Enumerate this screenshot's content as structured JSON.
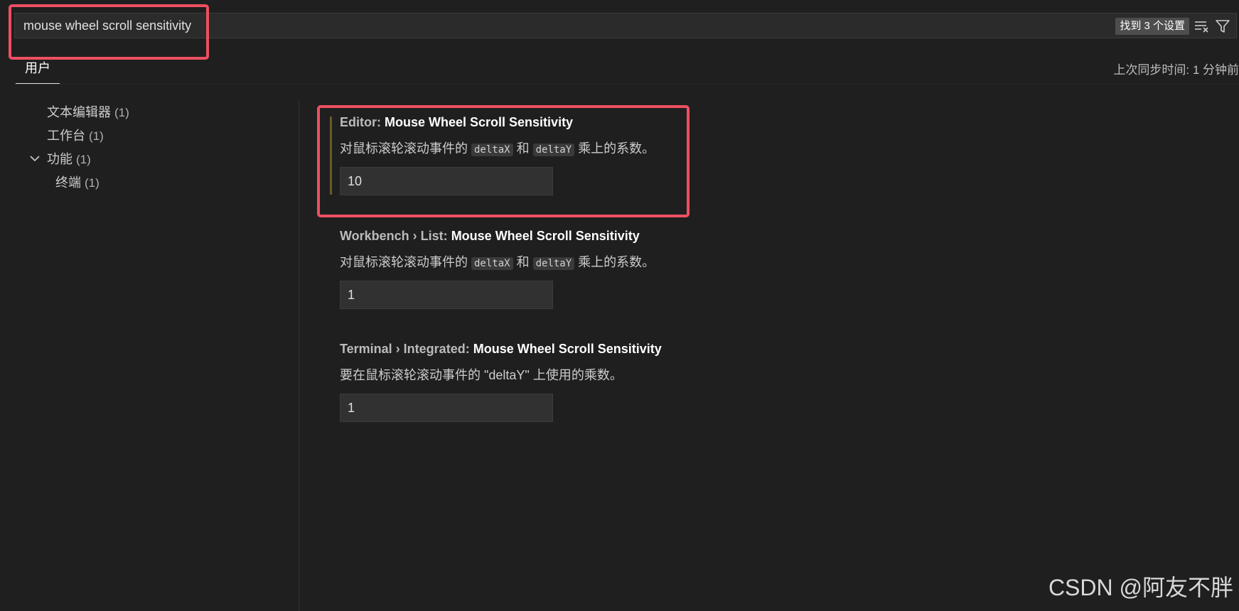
{
  "search": {
    "value": "mouse wheel scroll sensitivity",
    "result_badge": "找到 3 个设置",
    "clear_icon": "clear-filter-icon",
    "filter_icon": "funnel-icon"
  },
  "tabs": [
    {
      "label": "用户",
      "active": true
    }
  ],
  "sync_status": "上次同步时间: 1 分钟前",
  "tree": {
    "items": [
      {
        "label": "文本编辑器",
        "count": "(1)"
      },
      {
        "label": "工作台",
        "count": "(1)"
      },
      {
        "label": "功能",
        "count": "(1)",
        "expanded": true
      },
      {
        "label": "终端",
        "count": "(1)"
      }
    ]
  },
  "settings": [
    {
      "category": "Editor: ",
      "name": "Mouse Wheel Scroll Sensitivity",
      "desc_prefix": "对鼠标滚轮滚动事件的 ",
      "code1": "deltaX",
      "desc_mid": " 和 ",
      "code2": "deltaY",
      "desc_suffix": " 乘上的系数。",
      "value": "10",
      "modified": true
    },
    {
      "category": "Workbench › List: ",
      "name": "Mouse Wheel Scroll Sensitivity",
      "desc_prefix": "对鼠标滚轮滚动事件的 ",
      "code1": "deltaX",
      "desc_mid": " 和 ",
      "code2": "deltaY",
      "desc_suffix": " 乘上的系数。",
      "value": "1"
    },
    {
      "category": "Terminal › Integrated: ",
      "name": "Mouse Wheel Scroll Sensitivity",
      "description": "要在鼠标滚轮滚动事件的 \"deltaY\" 上使用的乘数。",
      "value": "1"
    }
  ],
  "watermark": "CSDN @阿友不胖",
  "colors": {
    "background": "#1f1f1f",
    "highlight": "#ee4f62",
    "modified_indicator": "#6b5b2a"
  }
}
